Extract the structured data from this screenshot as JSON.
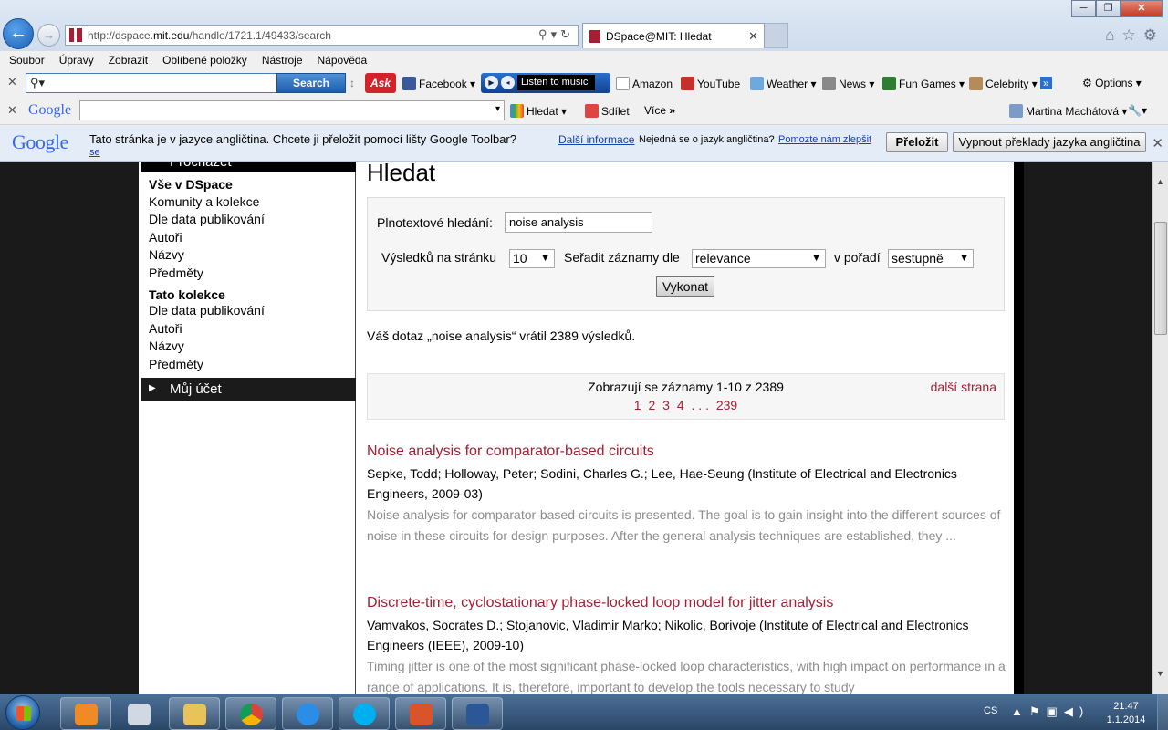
{
  "browser": {
    "url_prefix": "http://dspace.",
    "url_domain": "mit.edu",
    "url_path": "/handle/1721.1/49433/search",
    "tab_title": "DSpace@MIT: Hledat"
  },
  "menu": [
    "Soubor",
    "Úpravy",
    "Zobrazit",
    "Oblíbené položky",
    "Nástroje",
    "Nápověda"
  ],
  "ask_toolbar": {
    "search_label": "Search",
    "ask_logo": "Ask",
    "facebook": "Facebook",
    "listen": "Listen to music",
    "amazon": "Amazon",
    "youtube": "YouTube",
    "weather": "Weather",
    "news": "News",
    "fun_games": "Fun Games",
    "celebrity": "Celebrity",
    "options": "Options"
  },
  "google_toolbar": {
    "logo": "Google",
    "hledat": "Hledat",
    "sdilet": "Sdílet",
    "vice": "Více",
    "user": "Martina Machátová"
  },
  "translate_bar": {
    "logo": "Google",
    "message": "Tato stránka je v jazyce angličtina. Chcete ji přeložit pomocí lišty Google Toolbar?",
    "more_info": "Další informace",
    "not_english": "Nejedná se o jazyk angličtina?",
    "help_improve": "Pomozte nám zlepšit",
    "help_improve_2": "se",
    "translate_btn": "Přeložit",
    "never_translate_btn": "Vypnout překlady jazyka angličtina"
  },
  "sidebar": {
    "top_label": "Procházet",
    "section1_head": "Vše v DSpace",
    "section1_links": [
      "Komunity a kolekce",
      "Dle data publikování",
      "Autoři",
      "Názvy",
      "Předměty"
    ],
    "section2_head": "Tato kolekce",
    "section2_links": [
      "Dle data publikování",
      "Autoři",
      "Názvy",
      "Předměty"
    ],
    "account": "Můj účet"
  },
  "search": {
    "heading": "Hledat",
    "fulltext_label": "Plnotextové hledání:",
    "query": "noise analysis",
    "per_page_label": "Výsledků na stránku",
    "per_page_value": "10",
    "sort_label": "Seřadit záznamy dle",
    "sort_value": "relevance",
    "order_label": "v pořadí",
    "order_value": "sestupně",
    "submit": "Vykonat"
  },
  "results": {
    "summary": "Váš dotaz „noise analysis“ vrátil 2389 výsledků.",
    "showing": "Zobrazují se záznamy 1-10 z 2389",
    "next": "další strana",
    "pages": [
      "1",
      "2",
      "3",
      "4",
      ". . .",
      "239"
    ],
    "items": [
      {
        "title": "Noise analysis for comparator-based circuits",
        "authors": "Sepke, Todd; Holloway, Peter; Sodini, Charles G.; Lee, Hae-Seung (Institute of Electrical and Electronics Engineers, 2009-03)",
        "abstract": "Noise analysis for comparator-based circuits is presented. The goal is to gain insight into the different sources of noise in these circuits for design purposes. After the general analysis techniques are established, they ..."
      },
      {
        "title": "Discrete-time, cyclostationary phase-locked loop model for jitter analysis",
        "authors": "Vamvakos, Socrates D.; Stojanovic, Vladimir Marko; Nikolic, Borivoje (Institute of Electrical and Electronics Engineers (IEEE), 2009-10)",
        "abstract": "Timing jitter is one of the most significant phase-locked loop characteristics, with high impact on performance in a range of applications. It is, therefore, important to develop the tools necessary to study"
      }
    ]
  },
  "taskbar": {
    "lang": "CS",
    "time": "21:47",
    "date": "1.1.2014"
  },
  "colors": {
    "dspace_red": "#a31f34",
    "link_blue": "#1a3fb8",
    "abstract_gray": "#8c8c8c"
  }
}
